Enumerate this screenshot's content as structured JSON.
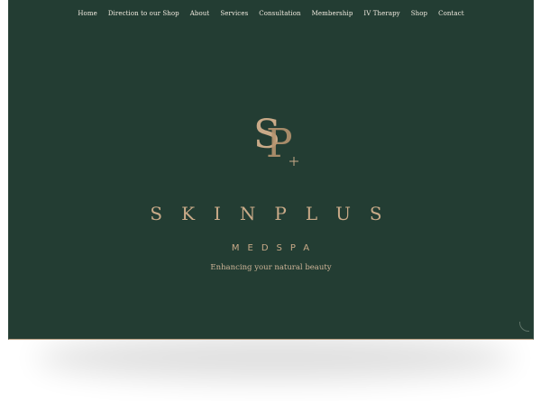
{
  "nav": {
    "items": [
      {
        "label": "Home"
      },
      {
        "label": "Direction to our Shop"
      },
      {
        "label": "About"
      },
      {
        "label": "Services"
      },
      {
        "label": "Consultation"
      },
      {
        "label": "Membership"
      },
      {
        "label": "IV Therapy"
      },
      {
        "label": "Shop"
      },
      {
        "label": "Contact"
      }
    ]
  },
  "hero": {
    "logo_icon": "sp-monogram-logo",
    "brand": "SKINPLUS",
    "subbrand": "MEDSPA",
    "tagline": "Enhancing your natural beauty"
  },
  "colors": {
    "background": "#233d33",
    "accent": "#c9aa88",
    "nav_text": "#f2ece1"
  }
}
